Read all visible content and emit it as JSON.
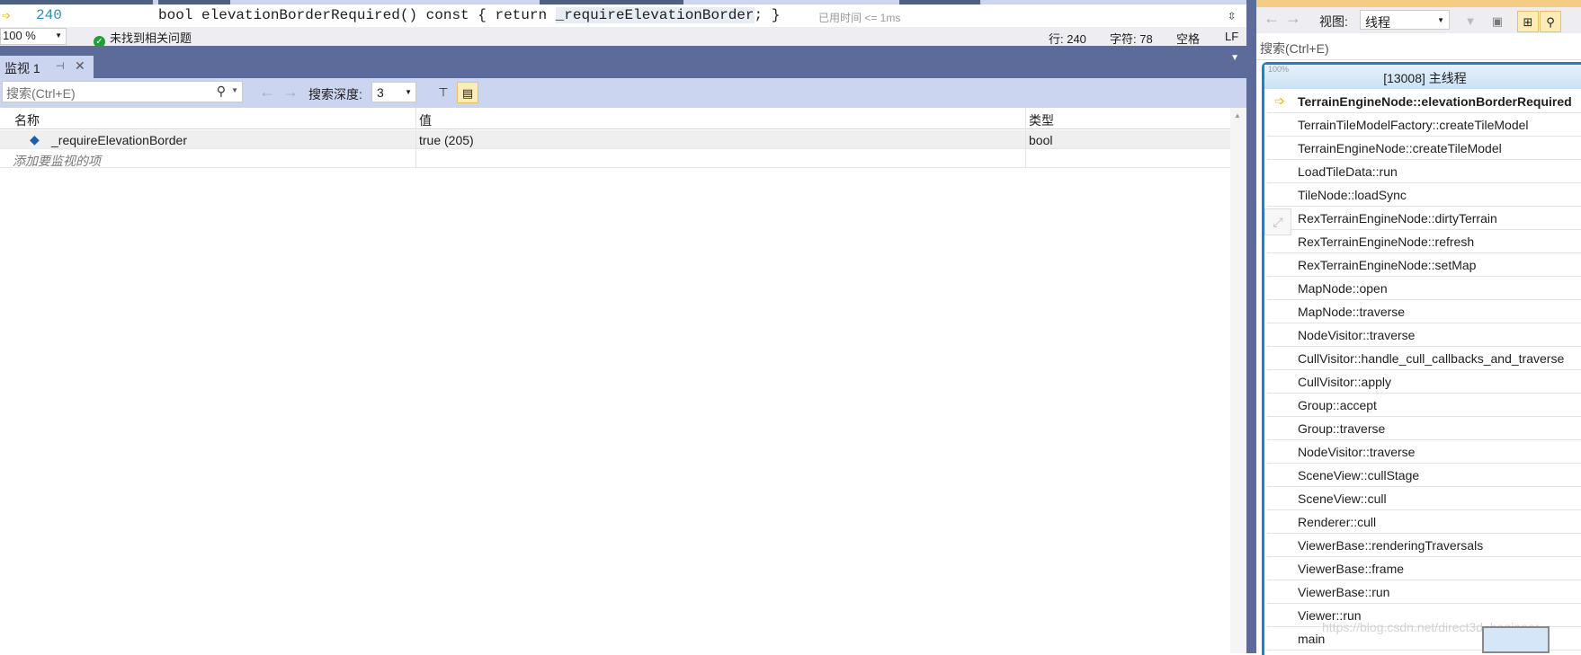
{
  "editor": {
    "line_number": "240",
    "code": "bool elevationBorderRequired() const { return ",
    "code_highlight": "_requireElevationBorder",
    "code_tail": "; }",
    "perf_tip": "已用时间 <= 1ms"
  },
  "status": {
    "zoom": "100 %",
    "issues": "未找到相关问题",
    "line": "行: 240",
    "char": "字符: 78",
    "spaces": "空格",
    "eol": "LF"
  },
  "watch": {
    "tab_label": "监视 1",
    "search_placeholder": "搜索(Ctrl+E)",
    "depth_label": "搜索深度:",
    "depth_value": "3",
    "columns": [
      "名称",
      "值",
      "类型"
    ],
    "rows": [
      {
        "name": "_requireElevationBorder",
        "value": "true (205)",
        "type": "bool"
      }
    ],
    "add_item_placeholder": "添加要监视的项"
  },
  "parallel": {
    "view_label": "视图:",
    "view_value": "线程",
    "search_placeholder": "搜索(Ctrl+E)",
    "zoom_pct": "100%",
    "thread_header": "[13008] 主线程",
    "frames": [
      "TerrainEngineNode::elevationBorderRequired",
      "TerrainTileModelFactory::createTileModel",
      "TerrainEngineNode::createTileModel",
      "LoadTileData::run",
      "TileNode::loadSync",
      "RexTerrainEngineNode::dirtyTerrain",
      "RexTerrainEngineNode::refresh",
      "RexTerrainEngineNode::setMap",
      "MapNode::open",
      "MapNode::traverse",
      "NodeVisitor::traverse",
      "CullVisitor::handle_cull_callbacks_and_traverse",
      "CullVisitor::apply",
      "Group::accept",
      "Group::traverse",
      "NodeVisitor::traverse",
      "SceneView::cullStage",
      "SceneView::cull",
      "Renderer::cull",
      "ViewerBase::renderingTraversals",
      "ViewerBase::frame",
      "ViewerBase::run",
      "Viewer::run",
      "main"
    ]
  },
  "watermark": "https://blog.csdn.net/direct3d_beginner",
  "colors": {
    "accent": "#5c6b99",
    "toolbar": "#ccd5f0",
    "current_frame_border": "#1b7fd8",
    "current_arrow": "#e6b800"
  }
}
